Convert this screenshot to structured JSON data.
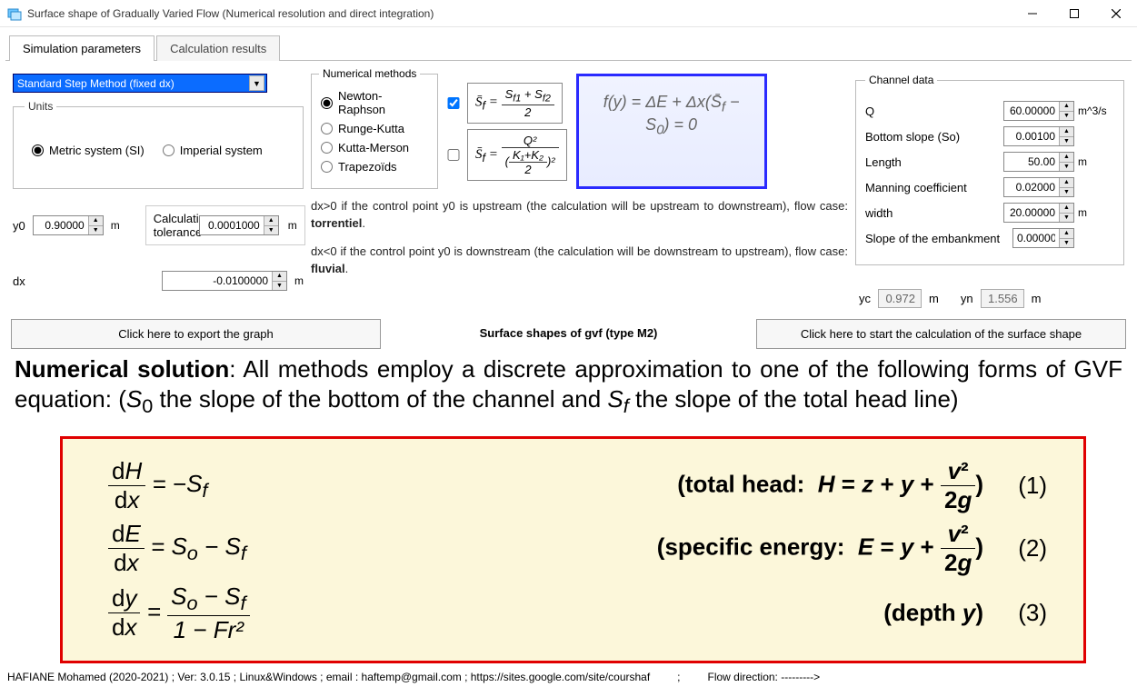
{
  "window": {
    "title": "Surface shape of Gradually Varied Flow (Numerical resolution and direct integration)"
  },
  "tabs": {
    "t0": "Simulation parameters",
    "t1": "Calculation results"
  },
  "method_select": "Standard Step Method (fixed dx)",
  "units_group": "Units",
  "units": {
    "metric": "Metric system (SI)",
    "imperial": "Imperial system"
  },
  "y0_label": "y0",
  "y0_value": "0.90000",
  "y0_unit": "m",
  "dx_label": "dx",
  "dx_value": "-0.0100000",
  "dx_unit": "m",
  "calc_tol_label": "Calculation tolerance",
  "calc_tol_value": "0.0001000",
  "calc_tol_unit": "m",
  "num_methods_group": "Numerical methods",
  "num_methods": {
    "nr": "Newton-Raphson",
    "rk": "Runge-Kutta",
    "km": "Kutta-Merson",
    "tz": "Trapezoïds"
  },
  "eq1": {
    "lhs": "S̄",
    "sub": "f",
    "num": "S_{f1} + S_{f2}",
    "den": "2"
  },
  "eq2": {
    "lhs": "S̄",
    "sub": "f",
    "q": "Q²",
    "k": "K₁+K₂",
    "two": "2"
  },
  "fy_text": "f(y) = ΔE + Δx(S̄_f − S_0) = 0",
  "help_p1a": "dx>0 if the control point y0 is upstream (the calculation will be upstream to downstream), flow case: ",
  "help_p1b": "torrentiel",
  "help_p2a": "dx<0 if the control point y0 is downstream (the calculation will be downstream to upstream), flow case: ",
  "help_p2b": "fluvial",
  "dot": ".",
  "channel": {
    "title": "Channel data",
    "Q": {
      "label": "Q",
      "value": "60.00000",
      "unit": "m^3/s"
    },
    "So": {
      "label": "Bottom slope (So)",
      "value": "0.00100"
    },
    "Length": {
      "label": "Length",
      "value": "50.00",
      "unit": "m"
    },
    "Manning": {
      "label": "Manning coefficient",
      "value": "0.02000"
    },
    "width": {
      "label": "width",
      "value": "20.00000",
      "unit": "m"
    },
    "embank": {
      "label": "Slope of the embankment",
      "value": "0.00000"
    }
  },
  "yc_label": "yc",
  "yc_value": "0.972",
  "yc_unit": "m",
  "yn_label": "yn",
  "yn_value": "1.556",
  "yn_unit": "m",
  "btn_export": "Click here to export the graph",
  "btn_center": "Surface shapes of gvf (type M2)",
  "btn_start": "Click here to start the calculation of the surface shape",
  "solution_heading_b": "Numerical solution",
  "solution_heading_rest1": ": All methods employ a discrete approximation to one of the following forms of GVF equation: (",
  "solution_heading_s0": "S₀",
  "solution_heading_rest2": " the slope of the bottom of the channel and ",
  "solution_heading_sf": "S_f",
  "solution_heading_rest3": " the slope of the total head line)",
  "eqs": {
    "r1_lhs_num": "dH",
    "r1_lhs_den": "dx",
    "r1_rhs": " = −S_f",
    "r1_mid": "(total head: H = z + y + ",
    "r1_frac_num": "v²",
    "r1_frac_den": "2g",
    "r1_close": ")",
    "r1_num": "(1)",
    "r2_lhs_num": "dE",
    "r2_lhs_den": "dx",
    "r2_rhs": " = S_o − S_f",
    "r2_mid": "(specific energy: E = y + ",
    "r2_frac_num": "v²",
    "r2_frac_den": "2g",
    "r2_close": ")",
    "r2_num": "(2)",
    "r3_lhs_num": "dy",
    "r3_lhs_den": "dx",
    "r3_frac_num": "S_o − S_f",
    "r3_frac_den": "1 − Fr²",
    "r3_eq": " = ",
    "r3_mid": "(depth y)",
    "r3_num": "(3)"
  },
  "status_left": "HAFIANE Mohamed (2020-2021) ; Ver: 3.0.15 ; Linux&Windows ; email : haftemp@gmail.com ; https://sites.google.com/site/courshaf",
  "status_sep": ";",
  "status_right": "Flow direction: --------->"
}
